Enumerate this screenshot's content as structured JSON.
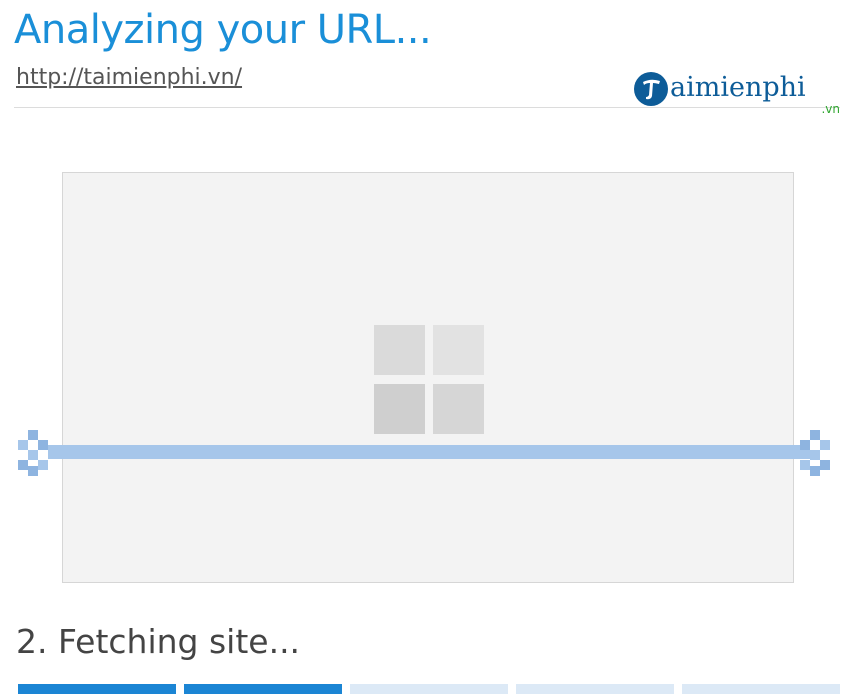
{
  "header": {
    "title": "Analyzing your URL...",
    "url": "http://taimienphi.vn/"
  },
  "logo": {
    "initial": "T",
    "text": "aimienphi",
    "suffix": ".vn",
    "badge_color": "#0d5c98",
    "suffix_color": "#2ea52e"
  },
  "preview": {
    "icon": "windows-tile-icon",
    "scan_color": "#a6c6ea"
  },
  "status": {
    "text": "2. Fetching site..."
  },
  "progress": {
    "total_steps": 5,
    "completed_steps": 2,
    "done_color": "#1b85d4",
    "todo_color": "#dce9f6"
  }
}
